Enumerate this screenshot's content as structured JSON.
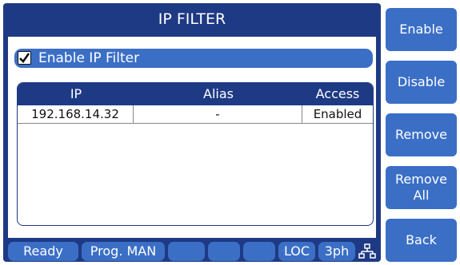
{
  "screen": {
    "title": "IP FILTER"
  },
  "filter_toggle": {
    "label": "Enable IP Filter",
    "checked": true
  },
  "table": {
    "headers": {
      "ip": "IP",
      "alias": "Alias",
      "access": "Access"
    },
    "rows": [
      {
        "ip": "192.168.14.32",
        "alias": "-",
        "access": "Enabled"
      }
    ]
  },
  "status_bar": {
    "ready": "Ready",
    "program": "Prog. MAN",
    "blank_1": "",
    "blank_2": "",
    "blank_3": "",
    "mode": "LOC",
    "phase": "3ph",
    "network_icon": "network-icon"
  },
  "softkeys": {
    "enable": "Enable",
    "disable": "Disable",
    "remove": "Remove",
    "remove_all_line1": "Remove",
    "remove_all_line2": "All",
    "back": "Back"
  },
  "colors": {
    "panel": "#1e3a84",
    "button": "#3b6fc6",
    "text_light": "#ffffff"
  }
}
